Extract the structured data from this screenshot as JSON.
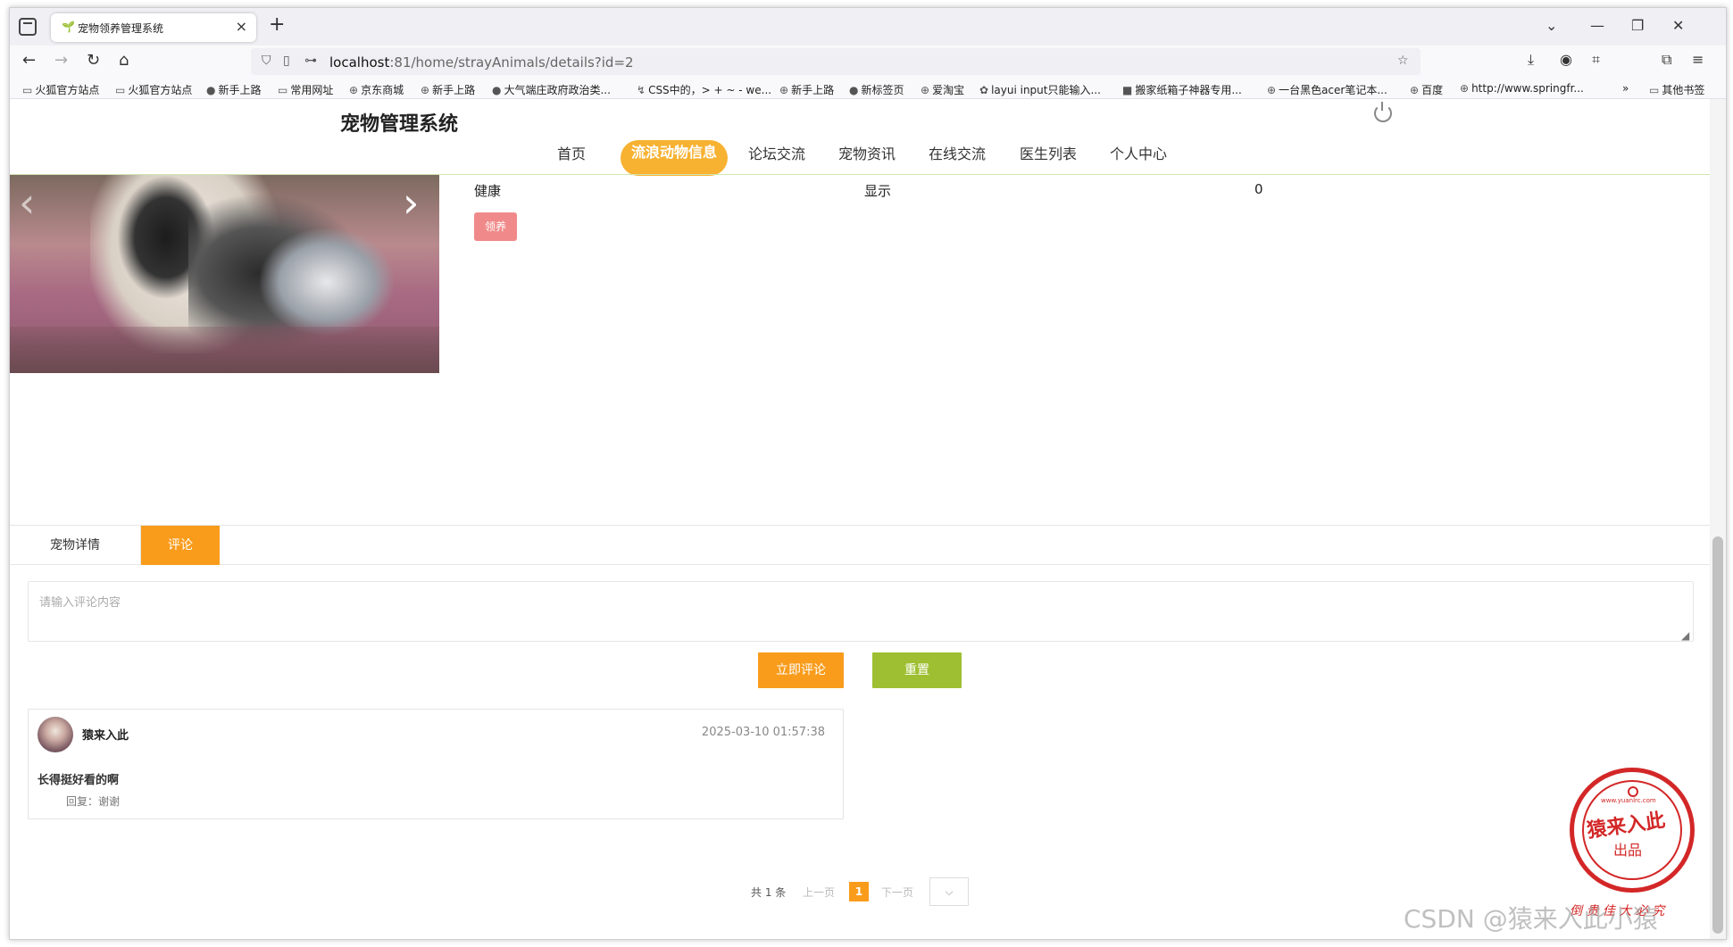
{
  "browser": {
    "tab_title": "宠物领养管理系统",
    "tab_favicon": "🌱",
    "tab_close": "×",
    "new_tab": "+",
    "url_host": "localhost",
    "url_rest": ":81/home/strayAnimals/details?id=2",
    "win_min": "—",
    "win_restore": "❐",
    "win_close": "✕",
    "win_list": "⌄"
  },
  "bookmarks": [
    "火狐官方站点",
    "火狐官方站点",
    "新手上路",
    "常用网址",
    "京东商城",
    "新手上路",
    "大气端庄政府政治类...",
    "CSS中的，> + ~ - we...",
    "新手上路",
    "新标签页",
    "爱淘宝",
    "layui input只能输入...",
    "搬家纸箱子神器专用...",
    "一台黑色acer笔记本...",
    "百度",
    "http://www.springfr...",
    "其他书签"
  ],
  "site": {
    "title": "宠物管理系统",
    "menu": [
      "首页",
      "流浪动物信息",
      "论坛交流",
      "宠物资讯",
      "在线交流",
      "医生列表",
      "个人中心"
    ]
  },
  "carousel": {
    "prev": "‹",
    "next": "›"
  },
  "animal": {
    "health": "健康",
    "display": "显示",
    "count": "0",
    "adopt_label": "领养"
  },
  "tabs": {
    "details": "宠物详情",
    "comment": "评论"
  },
  "comment_form": {
    "placeholder": "请输入评论内容",
    "submit_label": "立即评论",
    "reset_label": "重置"
  },
  "comments": [
    {
      "user": "猿来入此",
      "time": "2025-03-10 01:57:38",
      "text": "长得挺好看的啊",
      "reply": "回复：谢谢"
    }
  ],
  "pager": {
    "total": "共 1 条",
    "prev": "上一页",
    "current": "1",
    "next": "下一页",
    "select": "⌵"
  },
  "stamp": {
    "main": "猿来入此",
    "sub": "出品",
    "url": "www.yuanlrc.com",
    "bottom": "倒 贵 佳 大 必 究"
  },
  "watermark": "CSDN @猿来入此小猿"
}
